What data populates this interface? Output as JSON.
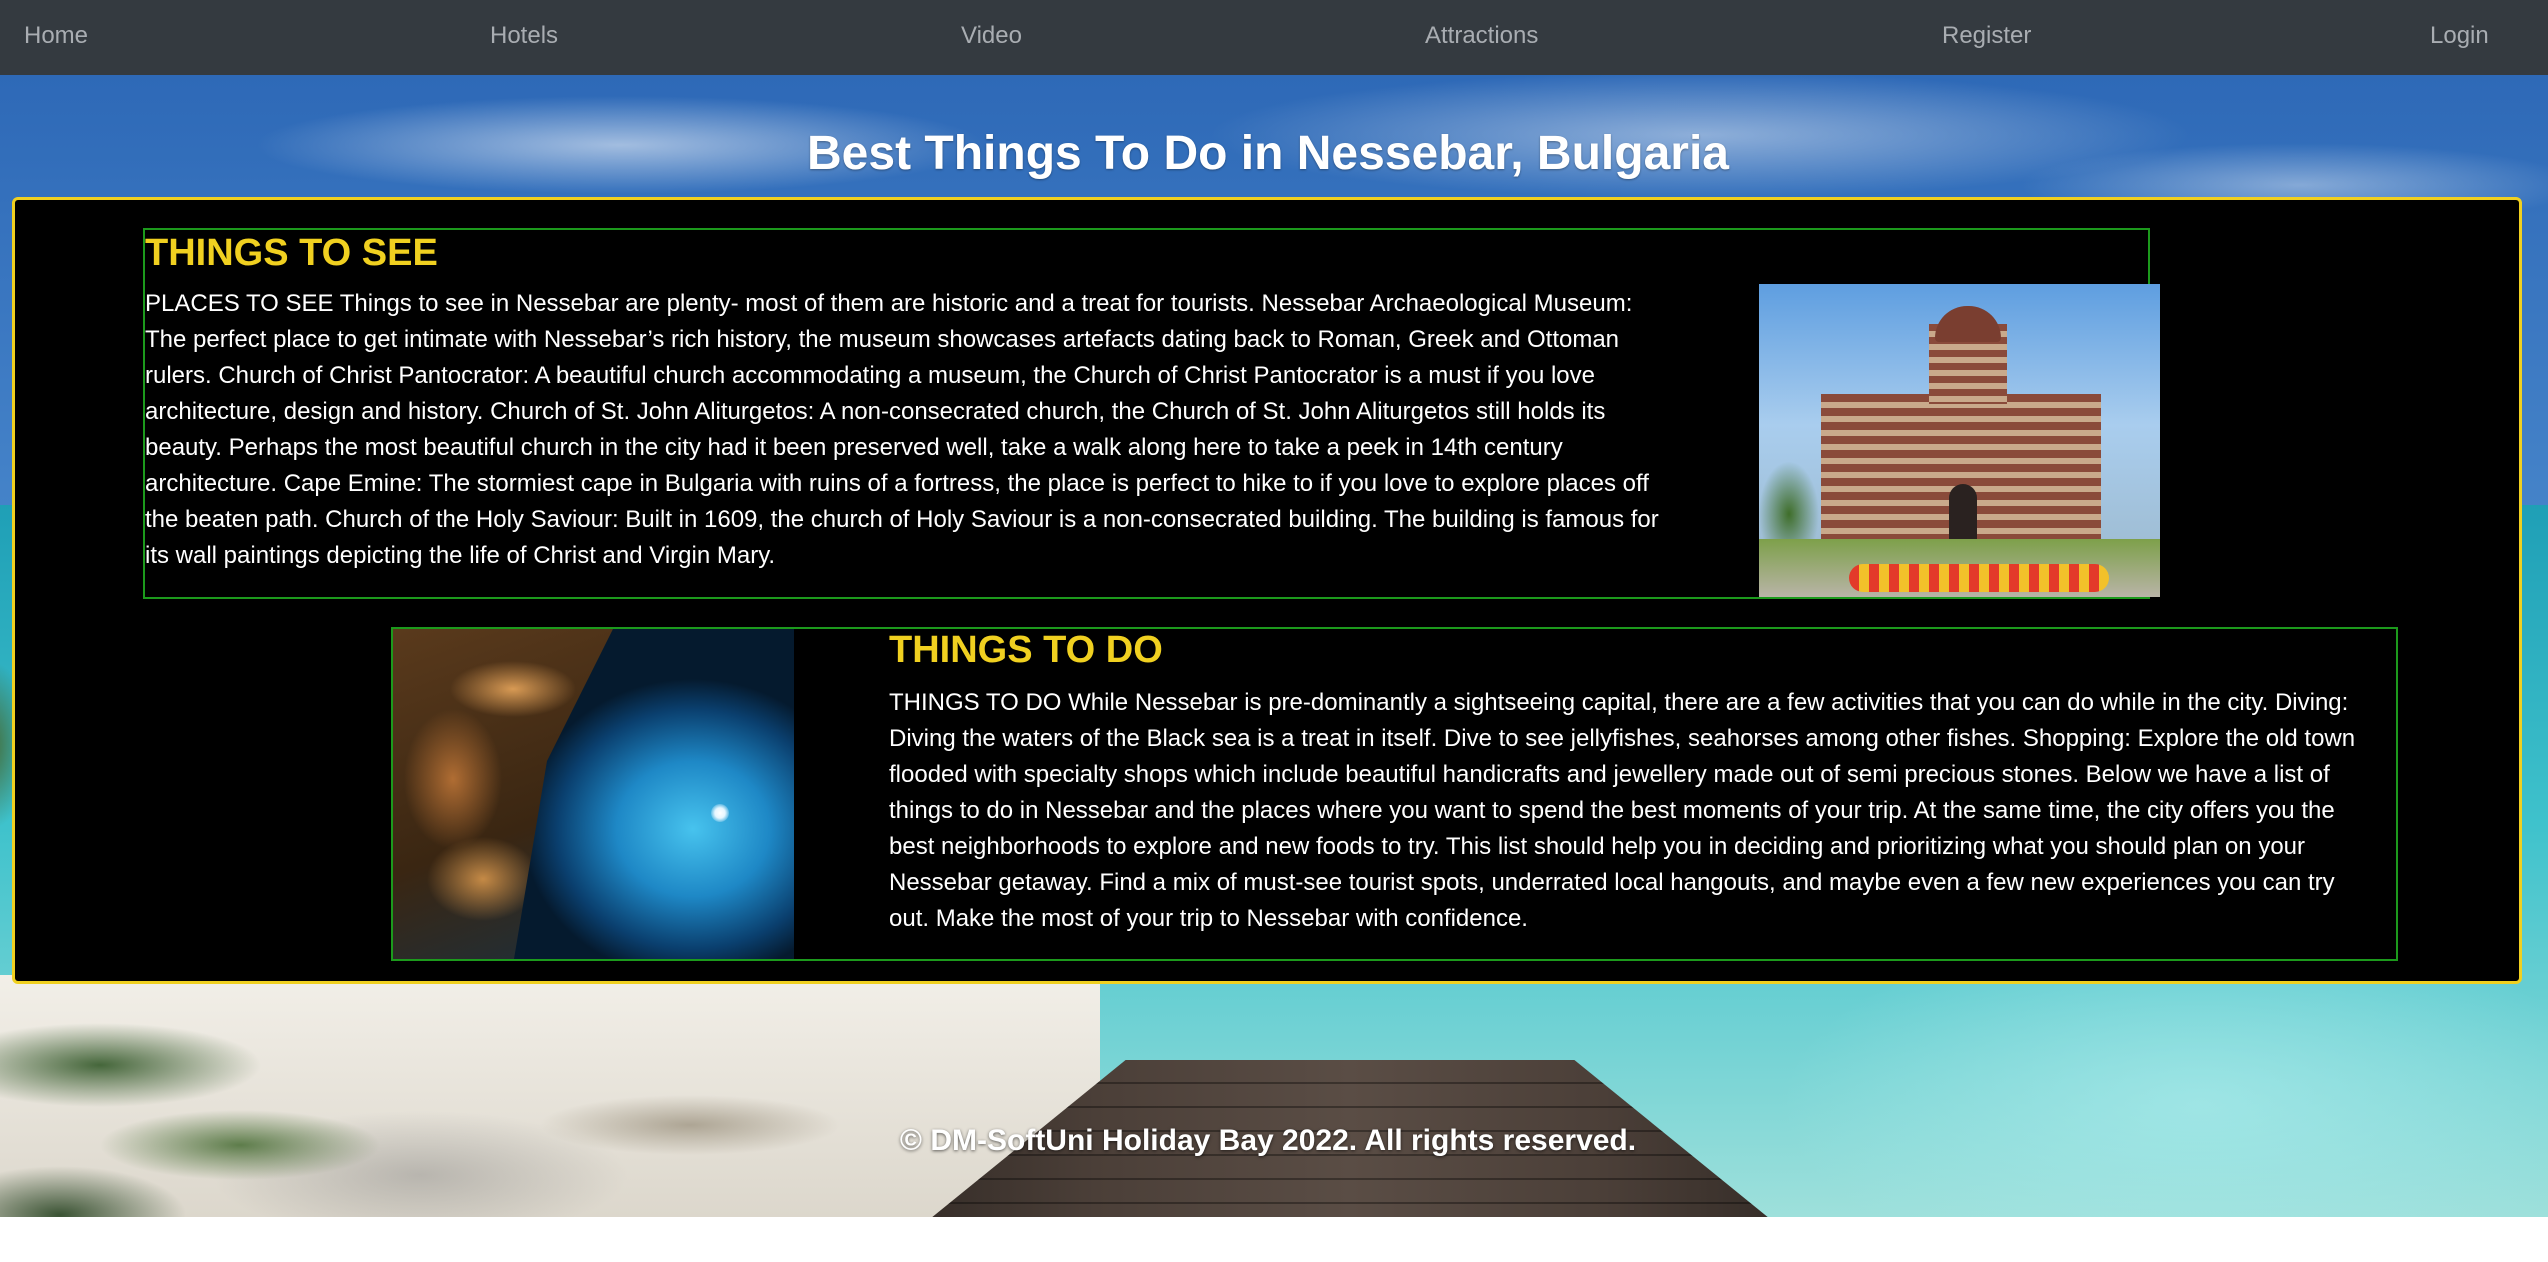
{
  "nav": {
    "home": "Home",
    "hotels": "Hotels",
    "video": "Video",
    "attractions": "Attractions",
    "register": "Register",
    "login": "Login"
  },
  "page_title": "Best Things To Do in Nessebar, Bulgaria",
  "sections": {
    "see": {
      "heading": "THINGS TO SEE",
      "text": "PLACES TO SEE Things to see in Nessebar are plenty- most of them are historic and a treat for tourists. Nessebar Archaeological Museum: The perfect place to get intimate with Nessebar’s rich history, the museum showcases artefacts dating back to Roman, Greek and Ottoman rulers. Church of Christ Pantocrator: A beautiful church accommodating a museum, the Church of Christ Pantocrator is a must if you love architecture, design and history. Church of St. John Aliturgetos: A non-consecrated church, the Church of St. John Aliturgetos still holds its beauty. Perhaps the most beautiful church in the city had it been preserved well, take a walk along here to take a peek in 14th century architecture. Cape Emine: The stormiest cape in Bulgaria with ruins of a fortress, the place is perfect to hike to if you love to explore places off the beaten path. Church of the Holy Saviour: Built in 1609, the church of Holy Saviour is a non-consecrated building. The building is famous for its wall paintings depicting the life of Christ and Virgin Mary.",
      "image": "church-photo"
    },
    "do": {
      "heading": "THINGS TO DO",
      "text": "THINGS TO DO While Nessebar is pre-dominantly a sightseeing capital, there are a few activities that you can do while in the city. Diving: Diving the waters of the Black sea is a treat in itself. Dive to see jellyfishes, seahorses among other fishes. Shopping: Explore the old town flooded with specialty shops which include beautiful handicrafts and jewellery made out of semi precious stones. Below we have a list of things to do in Nessebar and the places where you want to spend the best moments of your trip. At the same time, the city offers you the best neighborhoods to explore and new foods to try. This list should help you in deciding and prioritizing what you should plan on your Nessebar getaway. Find a mix of must-see tourist spots, underrated local hangouts, and maybe even a few new experiences you can try out. Make the most of your trip to Nessebar with confidence.",
      "image": "underwater-diving-photo"
    }
  },
  "footer": "© DM-SoftUni Holiday Bay 2022. All rights reserved.",
  "colors": {
    "navbar_bg": "#343a40",
    "nav_link": "#a9adb2",
    "heading_accent": "#f0d020",
    "section_border": "#1c9a1c",
    "content_border": "#f0d020"
  }
}
